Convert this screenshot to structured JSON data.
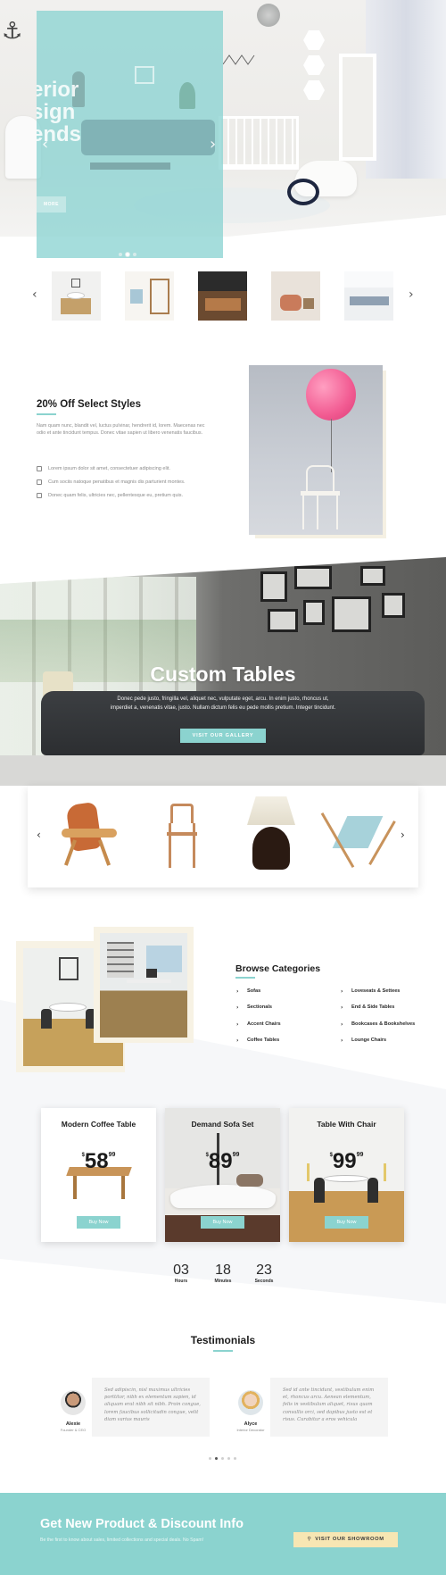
{
  "hero": {
    "slider_title": "erior\nsign\nends",
    "more_label": "MORE",
    "prev_icon": "chevron-left-icon",
    "next_icon": "chevron-right-icon"
  },
  "thumbnails": {
    "prev_icon": "chevron-left-icon",
    "next_icon": "chevron-right-icon",
    "count": 5
  },
  "promo": {
    "title": "20% Off Select Styles",
    "text": "Nam quam nunc, blandit vel, luctus pulvinar, hendrerit id, lorem. Maecenas nec odio et ante tincidunt tempus. Donec vitae sapien ut libero venenatis faucibus.",
    "items": [
      "Lorem ipsum dolor sit amet, consectetuer adipiscing elit.",
      "Cum sociis natoque penatibus et magnis dis parturient montes.",
      "Donec quam felis, ultricies nec, pellentesque eu, pretium quis."
    ]
  },
  "custom_tables": {
    "title": "Custom Tables",
    "text": "Donec pede justo, fringilla vel, aliquet nec, vulputate eget, arcu. In enim justo, rhoncus ut, imperdiet a, venenatis vitae, justo. Nullam dictum felis eu pede mollis pretium. Integer tincidunt.",
    "button": "VISIT OUR GALLERY"
  },
  "carousel": {
    "prev_icon": "chevron-left-icon",
    "next_icon": "chevron-right-icon",
    "items": [
      "lounge-chair",
      "wooden-chair",
      "table-lamp",
      "deck-chair"
    ]
  },
  "browse": {
    "title": "Browse Categories",
    "left": [
      "Sofas",
      "Sectionals",
      "Accent Chairs",
      "Coffee Tables"
    ],
    "right": [
      "Loveseats & Settees",
      "End & Side Tables",
      "Bookcases & Bookshelves",
      "Lounge Chairs"
    ]
  },
  "products": [
    {
      "name": "Modern Coffee Table",
      "currency": "$",
      "dollars": "58",
      "cents": "99",
      "button": "Buy Now"
    },
    {
      "name": "Demand Sofa Set",
      "currency": "$",
      "dollars": "89",
      "cents": "99",
      "button": "Buy Now"
    },
    {
      "name": "Table With Chair",
      "currency": "$",
      "dollars": "99",
      "cents": "99",
      "button": "Buy Now"
    }
  ],
  "countdown": [
    {
      "value": "03",
      "label": "Hours"
    },
    {
      "value": "18",
      "label": "Minutes"
    },
    {
      "value": "23",
      "label": "Seconds"
    }
  ],
  "testimonials": {
    "title": "Testimonials",
    "items": [
      {
        "quote": "Sed adipiscin, nisl maximus ultricies porttitor, nibh ex elementum sapien, id aliquam erat nibh sit nibh. Proin congue, lorem faucibus sollicitudin congue, velit diam varius mauris",
        "name": "Alexie",
        "role": "Founder & CEO"
      },
      {
        "quote": "Sed id ante tincidunt, vestibulum enim et, rhoncus arcu. Aenean elementum, felis in vestibulum aliquet, risus quam convallis orci, sed dapibus justo est et risus. Curabitur a eros vehicula",
        "name": "Alyce",
        "role": "Interior Decorator"
      }
    ]
  },
  "cta": {
    "title": "Get New Product & Discount Info",
    "subtitle": "Be the first to know about sales, limited collections and special deals. No Spam!",
    "button": "VISIT OUR SHOWROOM",
    "button_icon": "map-pin-icon"
  },
  "colors": {
    "accent": "#8bd3cf",
    "cta_button": "#f7e6b3",
    "text_dark": "#1d1d1d"
  }
}
